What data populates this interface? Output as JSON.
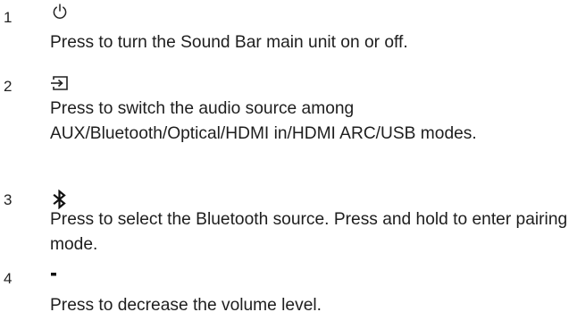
{
  "items": [
    {
      "number": "1",
      "icon": "power-icon",
      "description": "Press to turn the Sound Bar main unit on or off."
    },
    {
      "number": "2",
      "icon": "source-input-icon",
      "description": "Press to switch the audio source among AUX/Bluetooth/Optical/HDMI in/HDMI ARC/USB modes."
    },
    {
      "number": "3",
      "icon": "bluetooth-icon",
      "description": "Press to select the Bluetooth source. Press and hold to enter pairing mode."
    },
    {
      "number": "4",
      "icon": "minus-icon",
      "description": "Press to decrease the volume level."
    }
  ]
}
